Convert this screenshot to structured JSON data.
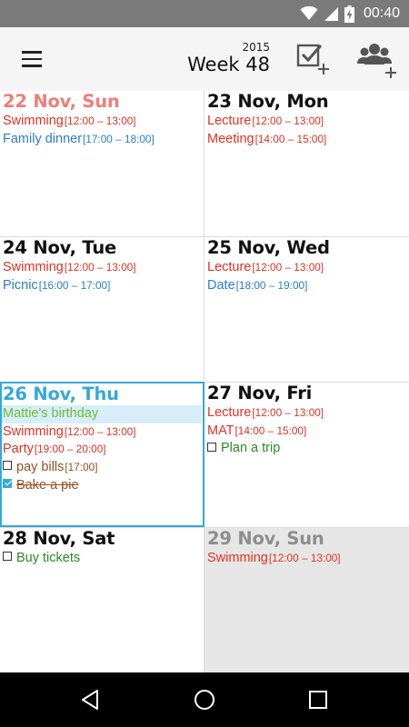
{
  "status_bar": {
    "time": "00:40",
    "icons": [
      "wifi-icon",
      "cell-signal-icon",
      "battery-charging-icon"
    ]
  },
  "app_bar": {
    "menu_icon": "hamburger-menu-icon",
    "year": "2015",
    "week_label": "Week 48",
    "add_task_icon": "add-task-icon",
    "add_people_icon": "add-people-icon"
  },
  "days": [
    {
      "date": "22 Nov, Sun",
      "events": [
        {
          "title": "Swimming",
          "time": "[12:00 – 13:00]"
        },
        {
          "title": "Family dinner",
          "time": "[17:00 – 18:00]"
        }
      ]
    },
    {
      "date": "23 Nov, Mon",
      "events": [
        {
          "title": "Lecture",
          "time": "[12:00 – 13:00]"
        },
        {
          "title": "Meeting",
          "time": "[14:00 – 15:00]"
        }
      ]
    },
    {
      "date": "24 Nov, Tue",
      "events": [
        {
          "title": "Swimming",
          "time": "[12:00 – 13:00]"
        },
        {
          "title": "Picnic",
          "time": "[16:00 – 17:00]"
        }
      ]
    },
    {
      "date": "25 Nov, Wed",
      "events": [
        {
          "title": "Lecture",
          "time": "[12:00 – 13:00]"
        },
        {
          "title": "Date",
          "time": "[18:00 – 19:00]"
        }
      ]
    },
    {
      "date": "26 Nov, Thu",
      "events": [
        {
          "title": "Mattie's birthday"
        },
        {
          "title": "Swimming",
          "time": "[12:00 – 13:00]"
        },
        {
          "title": "Party",
          "time": "[19:00 – 20:00]"
        },
        {
          "title": "pay bills",
          "time": "[17:00]"
        },
        {
          "title": "Bake a pie"
        }
      ]
    },
    {
      "date": "27 Nov, Fri",
      "events": [
        {
          "title": "Lecture",
          "time": "[12:00 – 13:00]"
        },
        {
          "title": "MAT",
          "time": "[14:00 – 15:00]"
        },
        {
          "title": "Plan a trip"
        }
      ]
    },
    {
      "date": "28 Nov, Sat",
      "events": [
        {
          "title": "Buy tickets"
        }
      ]
    },
    {
      "date": "29 Nov, Sun",
      "events": [
        {
          "title": "Swimming",
          "time": "[12:00 – 13:00]"
        }
      ]
    }
  ],
  "colors": {
    "event_red": "#e03222",
    "event_blue": "#2b7dc9",
    "task_green": "#2a8a22",
    "task_brown": "#9a4e1f",
    "today_accent": "#35a9d8",
    "sunday_red": "#f07e7a"
  },
  "nav_bar": {
    "icons": [
      "back-icon",
      "home-icon",
      "recents-icon"
    ]
  }
}
